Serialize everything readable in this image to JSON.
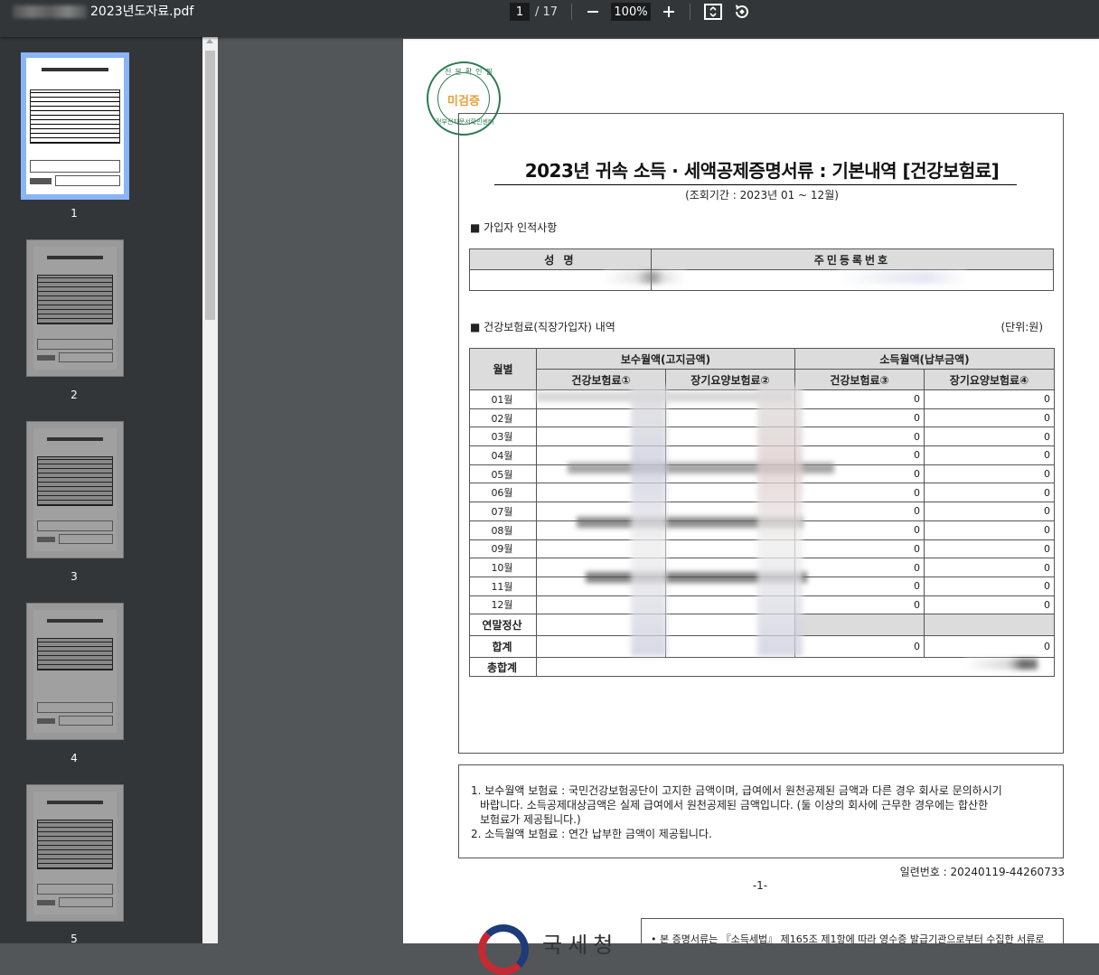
{
  "toolbar": {
    "file_name": "2023년도자료.pdf",
    "page_current": "1",
    "page_total": "/ 17",
    "zoom": "100%",
    "zoom_out_icon": "minus-icon",
    "zoom_in_icon": "plus-icon",
    "fit_icon": "fit-page-icon",
    "rotate_icon": "rotate-icon"
  },
  "sidebar": {
    "thumbnails": [
      {
        "label": "1",
        "active": true
      },
      {
        "label": "2",
        "active": false
      },
      {
        "label": "3",
        "active": false
      },
      {
        "label": "4",
        "active": false
      },
      {
        "label": "5",
        "active": false
      }
    ]
  },
  "document": {
    "stamp_ring": "진본확인필",
    "stamp_ring2": "정부전자문서확인센터",
    "stamp_text": "미검증",
    "title": "2023년 귀속 소득 · 세액공제증명서류 : 기본내역 [건강보험료]",
    "period": "(조회기간 : 2023년 01 ~ 12월)",
    "section1": "가입자 인적사항",
    "person_headers": [
      "성 명",
      "주민등록번호"
    ],
    "section2": "건강보험료(직장가입자) 내역",
    "unit": "(단위:원)",
    "table": {
      "month_header": "월별",
      "group1": "보수월액(고지금액)",
      "group2": "소득월액(납부금액)",
      "col1": "건강보험료①",
      "col2": "장기요양보험료②",
      "col3": "건강보험료③",
      "col4": "장기요양보험료④",
      "rows": [
        {
          "month": "01월",
          "c3": "0",
          "c4": "0"
        },
        {
          "month": "02월",
          "c3": "0",
          "c4": "0"
        },
        {
          "month": "03월",
          "c3": "0",
          "c4": "0"
        },
        {
          "month": "04월",
          "c3": "0",
          "c4": "0"
        },
        {
          "month": "05월",
          "c3": "0",
          "c4": "0"
        },
        {
          "month": "06월",
          "c3": "0",
          "c4": "0"
        },
        {
          "month": "07월",
          "c3": "0",
          "c4": "0"
        },
        {
          "month": "08월",
          "c3": "0",
          "c4": "0"
        },
        {
          "month": "09월",
          "c3": "0",
          "c4": "0"
        },
        {
          "month": "10월",
          "c3": "0",
          "c4": "0"
        },
        {
          "month": "11월",
          "c3": "0",
          "c4": "0"
        },
        {
          "month": "12월",
          "c3": "0",
          "c4": "0"
        }
      ],
      "year_end_label": "연말정산",
      "subtotal_label": "합계",
      "subtotal_c3": "0",
      "subtotal_c4": "0",
      "total_label": "총합계"
    },
    "notes": {
      "line1": "1. 보수월액 보험료 : 국민건강보험공단이 고지한 금액이며, 급여에서 원천공제된 금액과 다른 경우 회사로 문의하시기",
      "line2": "바랍니다. 소득공제대상금액은 실제 급여에서 원천공제된 금액입니다. (둘 이상의 회사에 근무한 경우에는 합산한",
      "line3": "보험료가 제공됩니다.)",
      "line4": "2. 소득월액 보험료 : 연간 납부한 금액이 제공됩니다."
    },
    "serial": "일련번호 : 20240119-44260733",
    "page_label": "-1-",
    "agency": "국세청",
    "footer_text": "• 본 증명서류는 『소득세법』 제165조 제1항에 따라 영수증 발급기관으로부터 수집한 서류로"
  }
}
